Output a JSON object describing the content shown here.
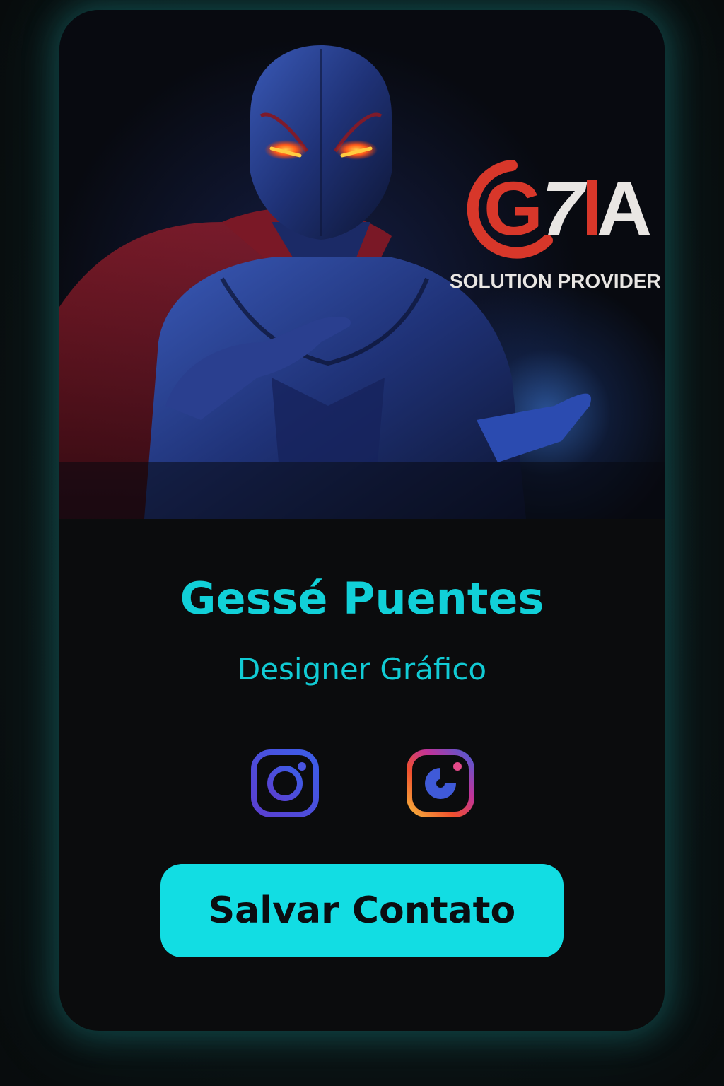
{
  "brand": {
    "logo_text": "G7IA",
    "tagline": "SOLUTION PROVIDER"
  },
  "profile": {
    "name": "Gessé Puentes",
    "role": "Designer Gráfico"
  },
  "socials": [
    {
      "icon": "instagram-icon"
    },
    {
      "icon": "instagram-gradient-icon"
    }
  ],
  "actions": {
    "save_label": "Salvar Contato"
  },
  "colors": {
    "accent": "#12dde3",
    "name_text": "#11d0d8",
    "logo_red": "#d8372a",
    "logo_white": "#e9e6e3",
    "background": "#0b0c0d"
  }
}
